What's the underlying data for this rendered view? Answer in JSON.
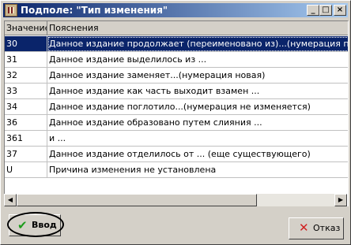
{
  "window": {
    "title": "Подполе: \"Тип изменения\"",
    "minimize_glyph": "_",
    "maximize_glyph": "□",
    "close_glyph": "×",
    "title_icon": "app-icon"
  },
  "table": {
    "headers": [
      "Значение",
      "Пояснения"
    ],
    "rows": [
      {
        "value": "30",
        "note": "Данное издание продолжает (переименовано из)...(нумерация продолжается)",
        "selected": true
      },
      {
        "value": "31",
        "note": "Данное издание выделилось из ..."
      },
      {
        "value": "32",
        "note": "Данное издание заменяет...(нумерация новая)"
      },
      {
        "value": "33",
        "note": "Данное издание как часть выходит взамен ..."
      },
      {
        "value": "34",
        "note": "Данное издание поглотило...(нумерация не изменяется)"
      },
      {
        "value": "36",
        "note": "Данное издание образовано путем слияния ..."
      },
      {
        "value": "361",
        "note": "и ..."
      },
      {
        "value": "37",
        "note": "Данное издание отделилось от ... (еще существующего)"
      },
      {
        "value": "U",
        "note": "Причина изменения не установлена"
      }
    ]
  },
  "scrollbar": {
    "left_arrow": "◀",
    "right_arrow": "▶"
  },
  "buttons": {
    "ok_label": "Ввод",
    "ok_icon": "check-icon",
    "cancel_label": "Отказ",
    "cancel_icon": "x-icon"
  },
  "colors": {
    "selection": "#0a246a",
    "title_start": "#0a246a",
    "title_end": "#a6caf0",
    "check": "#1c9c1c",
    "cross": "#d02020"
  }
}
